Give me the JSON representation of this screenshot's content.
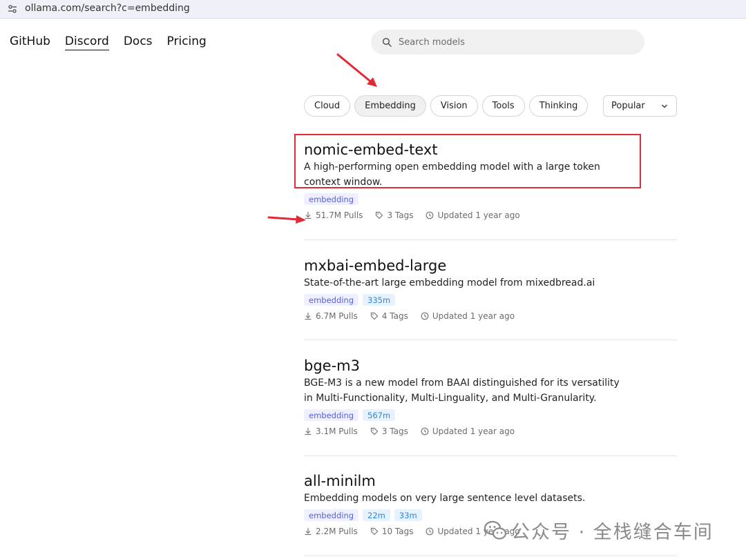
{
  "browser": {
    "url": "ollama.com/search?c=embedding"
  },
  "nav": {
    "links": [
      "GitHub",
      "Discord",
      "Docs",
      "Pricing"
    ]
  },
  "search": {
    "placeholder": "Search models"
  },
  "filters": {
    "pills": [
      "Cloud",
      "Embedding",
      "Vision",
      "Tools",
      "Thinking"
    ],
    "active": "Embedding",
    "sort": "Popular"
  },
  "models": [
    {
      "name": "nomic-embed-text",
      "desc": "A high-performing open embedding model with a large token context window.",
      "badges": [
        "embedding"
      ],
      "pulls": "51.7M Pulls",
      "tags": "3 Tags",
      "updated": "Updated 1 year ago"
    },
    {
      "name": "mxbai-embed-large",
      "desc": "State-of-the-art large embedding model from mixedbread.ai",
      "badges": [
        "embedding",
        "335m"
      ],
      "pulls": "6.7M Pulls",
      "tags": "4 Tags",
      "updated": "Updated 1 year ago"
    },
    {
      "name": "bge-m3",
      "desc": "BGE-M3 is a new model from BAAI distinguished for its versatility in Multi-Functionality, Multi-Linguality, and Multi-Granularity.",
      "badges": [
        "embedding",
        "567m"
      ],
      "pulls": "3.1M Pulls",
      "tags": "3 Tags",
      "updated": "Updated 1 year ago"
    },
    {
      "name": "all-minilm",
      "desc": "Embedding models on very large sentence level datasets.",
      "badges": [
        "embedding",
        "22m",
        "33m"
      ],
      "pulls": "2.2M Pulls",
      "tags": "10 Tags",
      "updated": "Updated 1 year ago"
    }
  ],
  "watermark": {
    "text": "公众号 · 全栈缝合车间"
  },
  "colors": {
    "annotation_red": "#e02a36",
    "badge_purple": "#5a5fd6",
    "badge_blue": "#2f86d6"
  }
}
